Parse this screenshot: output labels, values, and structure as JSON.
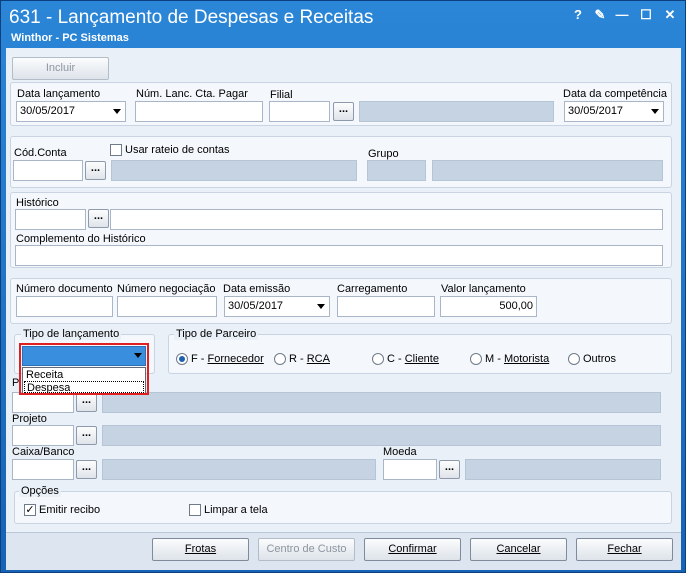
{
  "window": {
    "title": "631 - Lançamento de Despesas e Receitas",
    "subtitle": "Winthor - PC Sistemas",
    "controls": [
      "?",
      "✎",
      "—",
      "☐",
      "✕"
    ]
  },
  "toolbar": {
    "incluir_label": "Incluir"
  },
  "header": {
    "data_lancamento_label": "Data lançamento",
    "data_lancamento_value": "30/05/2017",
    "num_lanc_label": "Núm. Lanc. Cta. Pagar",
    "num_lanc_value": "",
    "filial_label": "Filial",
    "filial_value": "",
    "data_competencia_label": "Data da competência",
    "data_competencia_value": "30/05/2017"
  },
  "conta": {
    "cod_conta_label": "Cód.Conta",
    "usar_rateio_label": "Usar rateio de contas",
    "usar_rateio_checked": false,
    "grupo_label": "Grupo"
  },
  "historico": {
    "historico_label": "Histórico",
    "complemento_label": "Complemento do Histórico"
  },
  "documento": {
    "numero_documento_label": "Número documento",
    "numero_negociacao_label": "Número negociação",
    "data_emissao_label": "Data emissão",
    "data_emissao_value": "30/05/2017",
    "carregamento_label": "Carregamento",
    "valor_lancamento_label": "Valor lançamento",
    "valor_lancamento_value": "500,00"
  },
  "tipo_lancamento": {
    "label": "Tipo de lançamento",
    "selected": "",
    "options": [
      "Receita",
      "Despesa"
    ]
  },
  "tipo_parceiro": {
    "label": "Tipo de Parceiro",
    "options": [
      {
        "key": "F",
        "text": "Fornecedor",
        "checked": true
      },
      {
        "key": "R",
        "text": "RCA",
        "checked": false
      },
      {
        "key": "C",
        "text": "Cliente",
        "checked": false
      },
      {
        "key": "M",
        "text": "Motorista",
        "checked": false
      },
      {
        "key": "",
        "text": "Outros",
        "checked": false
      }
    ]
  },
  "parceiro": {
    "label_partial": "P"
  },
  "projeto": {
    "label": "Projeto"
  },
  "caixa": {
    "caixa_label": "Caixa/Banco",
    "moeda_label": "Moeda"
  },
  "opcoes": {
    "label": "Opções",
    "emitir_recibo_label": "Emitir recibo",
    "emitir_recibo_checked": true,
    "limpar_tela_label": "Limpar a tela",
    "limpar_tela_checked": false
  },
  "footer": {
    "frotas": "Frotas",
    "centro_custo": "Centro de Custo",
    "confirmar": "Confirmar",
    "cancelar": "Cancelar",
    "fechar": "Fechar"
  },
  "colors": {
    "title_bar": "#1762b4",
    "highlight_border": "#e02020",
    "selection": "#3a8ede"
  }
}
